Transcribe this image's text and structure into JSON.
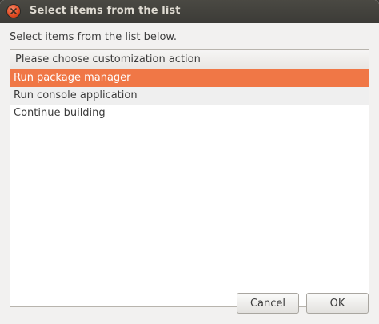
{
  "window": {
    "title": "Select items from the list"
  },
  "dialog": {
    "prompt": "Select items from the list below.",
    "list": {
      "header": "Please choose customization action",
      "items": [
        {
          "label": "Run package manager",
          "selected": true
        },
        {
          "label": "Run console application",
          "selected": false
        },
        {
          "label": "Continue building",
          "selected": false
        }
      ]
    },
    "buttons": {
      "cancel_label": "Cancel",
      "ok_label": "OK"
    }
  },
  "colors": {
    "selection": "#f07746",
    "titlebar": "#3c3b37",
    "close_button": "#e2481f"
  },
  "icons": {
    "close": "close-icon"
  }
}
